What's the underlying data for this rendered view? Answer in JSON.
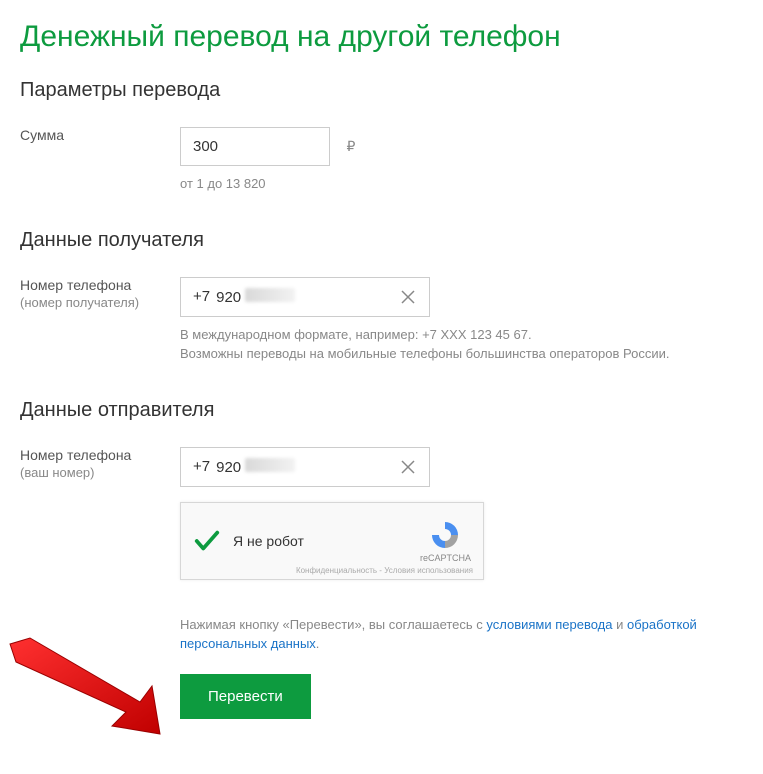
{
  "page": {
    "title": "Денежный перевод на другой телефон"
  },
  "sections": {
    "params": {
      "heading": "Параметры перевода",
      "amount": {
        "label": "Сумма",
        "value": "300",
        "currency": "₽",
        "hint": "от 1 до 13 820"
      }
    },
    "recipient": {
      "heading": "Данные получателя",
      "phone": {
        "label": "Номер телефона",
        "sublabel": "(номер получателя)",
        "prefix": "+7",
        "value": "920",
        "hint": "В международном формате, например: +7 XXX 123 45 67.\nВозможны переводы на мобильные телефоны большинства операторов России."
      }
    },
    "sender": {
      "heading": "Данные отправителя",
      "phone": {
        "label": "Номер телефона",
        "sublabel": "(ваш номер)",
        "prefix": "+7",
        "value": "920"
      }
    }
  },
  "recaptcha": {
    "label": "Я не робот",
    "brand": "reCAPTCHA",
    "terms": "Конфиденциальность - Условия использования"
  },
  "consent": {
    "prefix": "Нажимая кнопку «Перевести», вы соглашаетесь с ",
    "link1": "условиями перевода",
    "mid": " и ",
    "link2": "обработкой персональных данных",
    "suffix": "."
  },
  "submit": {
    "label": "Перевести"
  }
}
